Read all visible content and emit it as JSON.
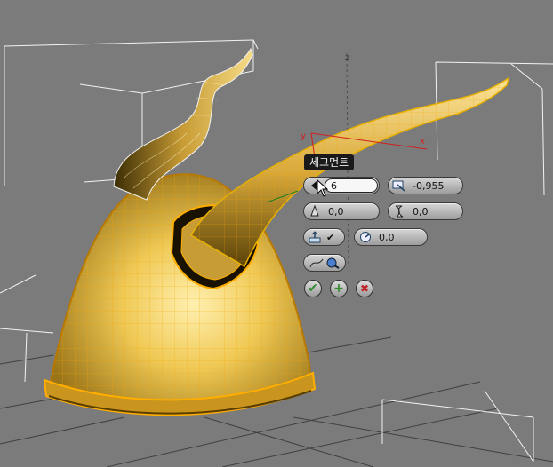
{
  "viewport": {
    "axis_z": "z",
    "axis_x": "x",
    "axis_y": "y"
  },
  "caddy": {
    "tooltip": "세그먼트",
    "segments": {
      "value": "6",
      "icon": "segments-spinner-icon"
    },
    "offset": {
      "value": "-0,955",
      "icon": "offset-icon"
    },
    "taper": {
      "value": "0,0",
      "icon": "taper-icon"
    },
    "twist": {
      "value": "0,0",
      "icon": "twist-icon"
    },
    "rotation": {
      "value": "0,0",
      "icon": "rotation-icon"
    },
    "align_icon": "align-to-normal-icon",
    "align_checked": "✔",
    "path_icon": "extrude-along-path-icon",
    "ok_label": "✔",
    "apply_label": "+",
    "cancel_label": "✖"
  },
  "colors": {
    "ok": "#2e8b2e",
    "apply": "#2e8b2e",
    "cancel": "#c0262a",
    "model": "#e6b334"
  }
}
